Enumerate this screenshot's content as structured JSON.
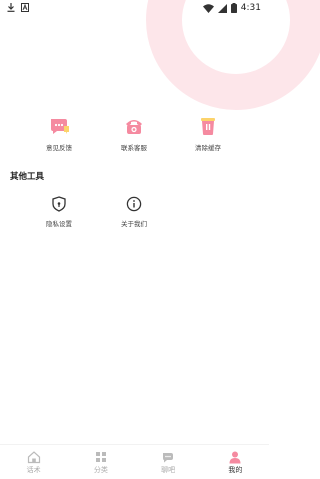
{
  "status_bar": {
    "time": "4:31"
  },
  "tools_row1": [
    {
      "label": "意见反馈",
      "icon": "feedback-icon"
    },
    {
      "label": "联系客服",
      "icon": "phone-icon"
    },
    {
      "label": "清除缓存",
      "icon": "trash-icon"
    }
  ],
  "other_tools": {
    "title": "其他工具",
    "items": [
      {
        "label": "隐私设置",
        "icon": "shield-icon"
      },
      {
        "label": "关于我们",
        "icon": "info-icon"
      }
    ]
  },
  "bottom_nav": [
    {
      "label": "话术",
      "icon": "home-icon",
      "active": false
    },
    {
      "label": "分类",
      "icon": "grid-icon",
      "active": false
    },
    {
      "label": "聊吧",
      "icon": "chat-icon",
      "active": false
    },
    {
      "label": "我的",
      "icon": "user-icon",
      "active": true
    }
  ],
  "colors": {
    "accent": "#f58aa0",
    "deco": "#fde6ea",
    "inactive": "#aaaaaa"
  }
}
